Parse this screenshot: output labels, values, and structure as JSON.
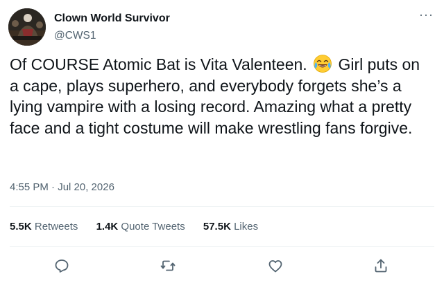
{
  "author": {
    "display_name": "Clown World Survivor",
    "handle": "@CWS1"
  },
  "tweet": {
    "text_before_emoji": "Of COURSE Atomic Bat is Vita Valenteen.",
    "emoji": "face-with-tears-of-joy",
    "text_after_emoji": "Girl puts on a cape, plays superhero, and everybody forgets she’s a lying vampire with a losing record. Amazing what a pretty face and a tight costume will make wrestling fans forgive.",
    "timestamp": "4:55 PM · Jul 20, 2026"
  },
  "stats": {
    "retweets_count": "5.5K",
    "retweets_label": "Retweets",
    "quotes_count": "1.4K",
    "quotes_label": "Quote Tweets",
    "likes_count": "57.5K",
    "likes_label": "Likes"
  },
  "menu": {
    "more_label": "···"
  },
  "actions": {
    "reply_icon": "reply-icon",
    "retweet_icon": "retweet-icon",
    "like_icon": "like-icon",
    "share_icon": "share-icon"
  },
  "colors": {
    "text_primary": "#0f1419",
    "text_secondary": "#536471",
    "divider": "#eff3f4"
  }
}
